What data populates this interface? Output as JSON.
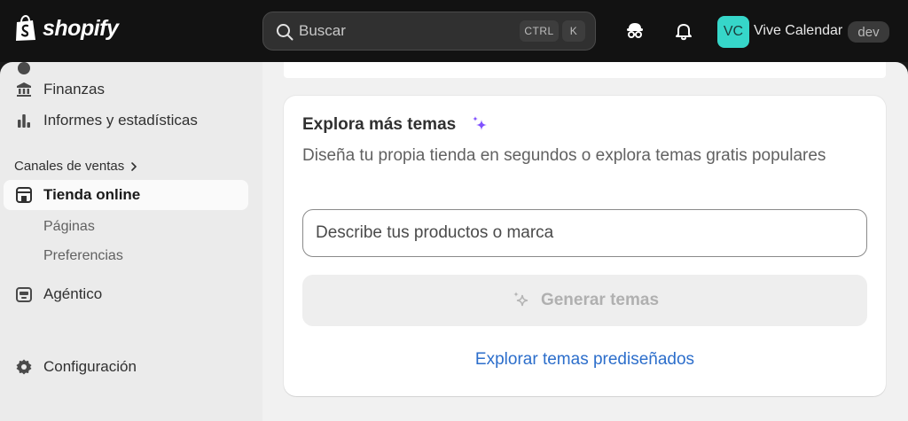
{
  "topbar": {
    "brand": "shopify",
    "search_placeholder": "Buscar",
    "shortcut_ctrl": "CTRL",
    "shortcut_k": "K",
    "avatar_initials": "VC",
    "store_name": "Vive Calendar",
    "store_badge": "dev",
    "icons": [
      "shopify-bag-icon",
      "search-icon",
      "spy-icon",
      "bell-icon"
    ]
  },
  "sidebar": {
    "items": [
      {
        "label": "Finanzas",
        "icon": "bank-icon"
      },
      {
        "label": "Informes y estadísticas",
        "icon": "bar-chart-icon"
      }
    ],
    "section_label": "Canales de ventas",
    "channel": {
      "label": "Tienda online",
      "icon": "store-icon",
      "active": true
    },
    "sub_items": [
      "Páginas",
      "Preferencias"
    ],
    "agentic": {
      "label": "Agéntico",
      "icon": "agent-icon"
    },
    "settings": {
      "label": "Configuración",
      "icon": "gear-icon"
    }
  },
  "card": {
    "title": "Explora más temas",
    "description": "Diseña tu propia tienda en segundos o explora temas gratis populares",
    "input_placeholder": "Describe tus productos o marca",
    "generate_label": "Generar temas",
    "explore_link": "Explorar temas prediseñados"
  },
  "colors": {
    "topbar": "#121212",
    "avatar": "#36d6c9",
    "link": "#2c6ecb",
    "sparkle": "#8051ff"
  }
}
